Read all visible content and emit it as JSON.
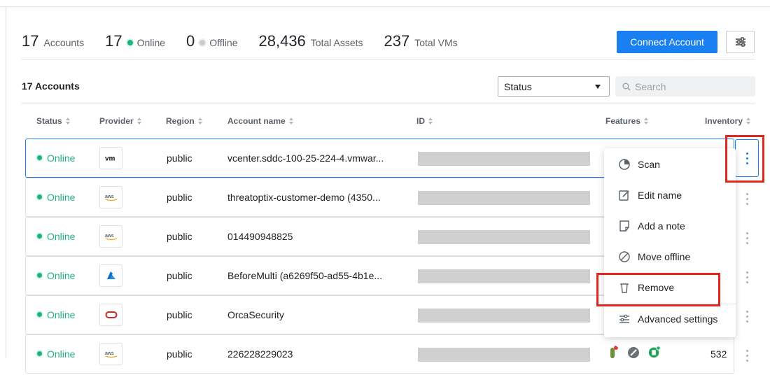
{
  "stats": {
    "accounts_num": "17",
    "accounts_label": "Accounts",
    "online_num": "17",
    "online_label": "Online",
    "offline_num": "0",
    "offline_label": "Offline",
    "assets_num": "28,436",
    "assets_label": "Total Assets",
    "vms_num": "237",
    "vms_label": "Total VMs"
  },
  "toolbar": {
    "connect_label": "Connect Account"
  },
  "list": {
    "count_label": "17 Accounts",
    "status_filter": "Status",
    "search_placeholder": "Search"
  },
  "columns": [
    "Status",
    "Provider",
    "Region",
    "Account name",
    "ID",
    "Features",
    "Inventory"
  ],
  "rows": [
    {
      "status": "Online",
      "provider": "vm",
      "region": "public",
      "name": "vcenter.sddc-100-25-224-4.vmwar...",
      "inventory": ""
    },
    {
      "status": "Online",
      "provider": "aws",
      "region": "public",
      "name": "threatoptix-customer-demo (4350...",
      "inventory": ""
    },
    {
      "status": "Online",
      "provider": "aws",
      "region": "public",
      "name": "014490948825",
      "inventory": ""
    },
    {
      "status": "Online",
      "provider": "azure",
      "region": "public",
      "name": "BeforeMulti (a6269f50-ad55-4b1e...",
      "inventory": ""
    },
    {
      "status": "Online",
      "provider": "oracle",
      "region": "public",
      "name": "OrcaSecurity",
      "inventory": ""
    },
    {
      "status": "Online",
      "provider": "aws",
      "region": "public",
      "name": "226228229023",
      "inventory": "532"
    }
  ],
  "menu": {
    "items": [
      {
        "label": "Scan",
        "icon": "scan-icon"
      },
      {
        "label": "Edit name",
        "icon": "edit-icon"
      },
      {
        "label": "Add a note",
        "icon": "note-icon"
      },
      {
        "label": "Move offline",
        "icon": "block-icon"
      },
      {
        "label": "Remove",
        "icon": "trash-icon"
      },
      {
        "label": "Advanced settings",
        "icon": "sliders-icon"
      }
    ]
  },
  "colors": {
    "accent": "#1a7ff0",
    "online": "#1fb27a",
    "highlight": "#e0271f"
  }
}
